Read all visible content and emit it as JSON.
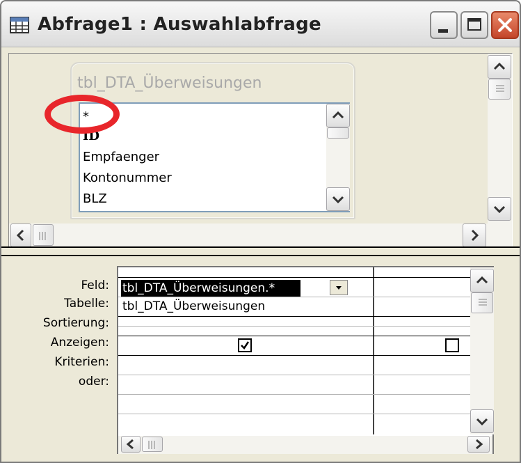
{
  "window": {
    "title": "Abfrage1 : Auswahlabfrage",
    "minimize_label": "_",
    "maximize_label": "□",
    "close_label": "✕"
  },
  "table": {
    "title": "tbl_DTA_Überweisungen",
    "fields": [
      "*",
      "ID",
      "Empfaenger",
      "Kontonummer",
      "BLZ"
    ]
  },
  "grid": {
    "row_labels": [
      "Feld:",
      "Tabelle:",
      "Sortierung:",
      "Anzeigen:",
      "Kriterien:",
      "oder:"
    ],
    "columns": [
      {
        "field": "tbl_DTA_Überweisungen.*",
        "table": "tbl_DTA_Überweisungen",
        "show": true
      },
      {
        "field": "",
        "table": "",
        "show": false
      }
    ]
  },
  "icons": {
    "scroll_up": "▲",
    "scroll_down": "▼",
    "scroll_left": "◀",
    "scroll_right": "▶",
    "dropdown": "▼",
    "check": "✔"
  },
  "highlight_color": "#e8262b"
}
